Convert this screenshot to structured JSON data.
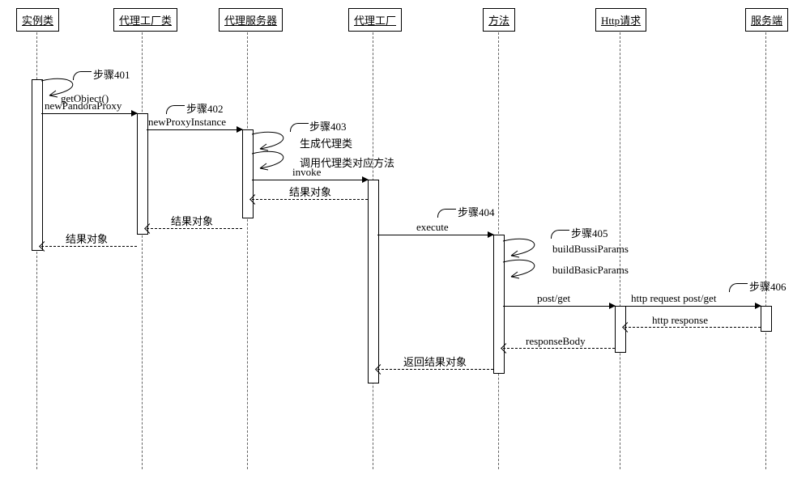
{
  "participants": {
    "p1": "实例类",
    "p2": "代理工厂类",
    "p3": "代理服务器",
    "p4": "代理工厂",
    "p5": "方法",
    "p6": "Http请求",
    "p7": "服务端"
  },
  "steps": {
    "s401": "步骤401",
    "s402": "步骤402",
    "s403": "步骤403",
    "s404": "步骤404",
    "s405": "步骤405",
    "s406": "步骤406"
  },
  "messages": {
    "getObject": "getObject()",
    "newPandoraProxy": "newPandoraProxy",
    "newProxyInstance": "newProxyInstance",
    "genProxyClass": "生成代理类",
    "callProxyMethod": "调用代理类对应方法",
    "invoke": "invoke",
    "resultObj": "结果对象",
    "execute": "execute",
    "buildBussiParams": "buildBussiParams",
    "buildBasicParams": "buildBasicParams",
    "postGet": "post/get",
    "httpReq": "http request post/get",
    "httpResp": "http response",
    "responseBody": "responseBody",
    "returnResult": "返回结果对象"
  },
  "chart_data": {
    "type": "sequence-diagram",
    "participants": [
      "实例类",
      "代理工厂类",
      "代理服务器",
      "代理工厂",
      "方法",
      "Http请求",
      "服务端"
    ],
    "interactions": [
      {
        "step": "步骤401",
        "from": "实例类",
        "to": "实例类",
        "label": "getObject()",
        "kind": "self"
      },
      {
        "from": "实例类",
        "to": "代理工厂类",
        "label": "newPandoraProxy",
        "kind": "call"
      },
      {
        "step": "步骤402",
        "from": "代理工厂类",
        "to": "代理服务器",
        "label": "newProxyInstance",
        "kind": "call"
      },
      {
        "step": "步骤403",
        "from": "代理服务器",
        "to": "代理服务器",
        "label": "生成代理类",
        "kind": "self"
      },
      {
        "from": "代理服务器",
        "to": "代理服务器",
        "label": "调用代理类对应方法",
        "kind": "self"
      },
      {
        "from": "代理服务器",
        "to": "代理工厂",
        "label": "invoke",
        "kind": "call"
      },
      {
        "from": "代理工厂",
        "to": "代理服务器",
        "label": "结果对象",
        "kind": "return"
      },
      {
        "from": "代理服务器",
        "to": "代理工厂类",
        "label": "结果对象",
        "kind": "return"
      },
      {
        "from": "代理工厂类",
        "to": "实例类",
        "label": "结果对象",
        "kind": "return"
      },
      {
        "step": "步骤404",
        "from": "代理工厂",
        "to": "方法",
        "label": "execute",
        "kind": "call"
      },
      {
        "step": "步骤405",
        "from": "方法",
        "to": "方法",
        "label": "buildBussiParams",
        "kind": "self"
      },
      {
        "from": "方法",
        "to": "方法",
        "label": "buildBasicParams",
        "kind": "self"
      },
      {
        "from": "方法",
        "to": "Http请求",
        "label": "post/get",
        "kind": "call"
      },
      {
        "step": "步骤406",
        "from": "Http请求",
        "to": "服务端",
        "label": "http request post/get",
        "kind": "call"
      },
      {
        "from": "服务端",
        "to": "Http请求",
        "label": "http response",
        "kind": "return"
      },
      {
        "from": "Http请求",
        "to": "方法",
        "label": "responseBody",
        "kind": "return"
      },
      {
        "from": "方法",
        "to": "代理工厂",
        "label": "返回结果对象",
        "kind": "return"
      }
    ]
  }
}
